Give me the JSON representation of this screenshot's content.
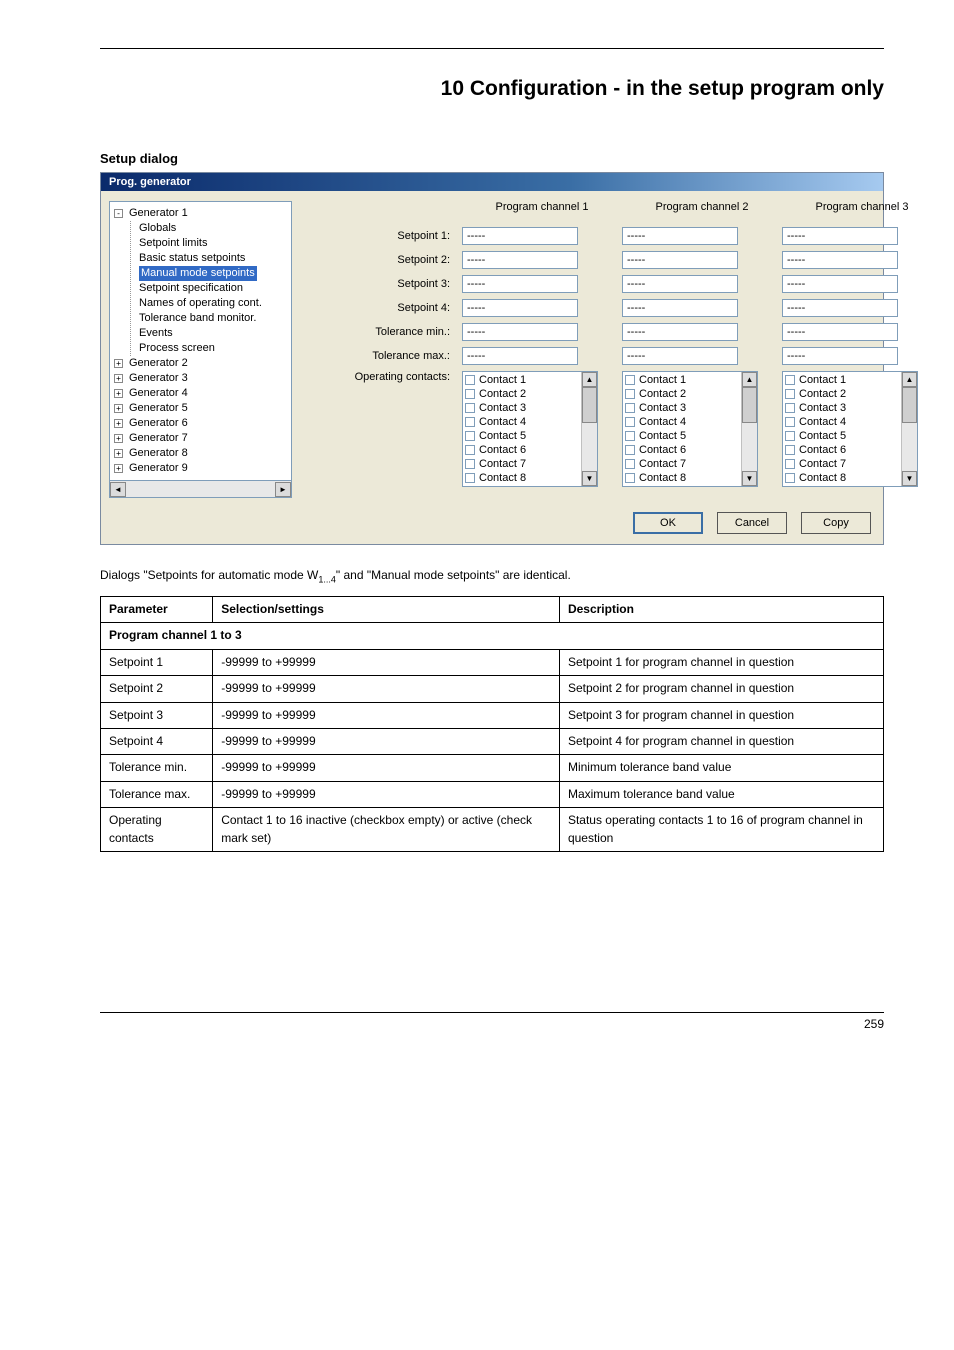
{
  "chapter": "10 Configuration - in the setup program only",
  "left_label": "Setup dialog",
  "window": {
    "title": "Prog. generator",
    "tree": {
      "root": "Generator 1",
      "children": [
        "Globals",
        "Setpoint limits",
        "Basic status setpoints",
        "Manual mode setpoints",
        "Setpoint specification",
        "Names of operating cont.",
        "Tolerance band monitor.",
        "Events",
        "Process screen"
      ],
      "selected": "Manual mode setpoints",
      "siblings": [
        "Generator 2",
        "Generator 3",
        "Generator 4",
        "Generator 5",
        "Generator 6",
        "Generator 7",
        "Generator 8",
        "Generator 9"
      ]
    },
    "channels": [
      "Program channel 1",
      "Program channel 2",
      "Program channel 3"
    ],
    "row_labels": {
      "sp1": "Setpoint 1:",
      "sp2": "Setpoint 2:",
      "sp3": "Setpoint 3:",
      "sp4": "Setpoint 4:",
      "tmin": "Tolerance min.:",
      "tmax": "Tolerance max.:",
      "oc": "Operating contacts:"
    },
    "placeholder": "-----",
    "contacts": [
      "Contact 1",
      "Contact 2",
      "Contact 3",
      "Contact 4",
      "Contact 5",
      "Contact 6",
      "Contact 7",
      "Contact 8"
    ],
    "buttons": {
      "ok": "OK",
      "cancel": "Cancel",
      "copy": "Copy"
    }
  },
  "note_prefix": "Dialogs \"Setpoints for automatic mode W",
  "note_sub": "1...4",
  "note_suffix": "\" and \"Manual mode setpoints\" are identical.",
  "table": {
    "headers": [
      "Parameter",
      "Selection/settings",
      "Description"
    ],
    "section": "Program channel 1 to 3",
    "rows": [
      {
        "p": "Setpoint 1",
        "s": "-99999 to +99999",
        "d": "Setpoint 1 for program channel in question"
      },
      {
        "p": "Setpoint 2",
        "s": "-99999 to +99999",
        "d": "Setpoint 2 for program channel in question"
      },
      {
        "p": "Setpoint 3",
        "s": "-99999 to +99999",
        "d": "Setpoint 3 for program channel in question"
      },
      {
        "p": "Setpoint 4",
        "s": "-99999 to +99999",
        "d": "Setpoint 4 for program channel in question"
      },
      {
        "p": "Tolerance min.",
        "s": "-99999 to +99999",
        "d": "Minimum tolerance band value"
      },
      {
        "p": "Tolerance max.",
        "s": "-99999 to +99999",
        "d": "Maximum tolerance band value"
      },
      {
        "p": "Operating contacts",
        "s": "Contact 1 to 16 inactive (checkbox empty) or active (check mark set)",
        "d": "Status operating contacts 1 to 16 of program channel in question"
      }
    ]
  },
  "page_number": "259"
}
